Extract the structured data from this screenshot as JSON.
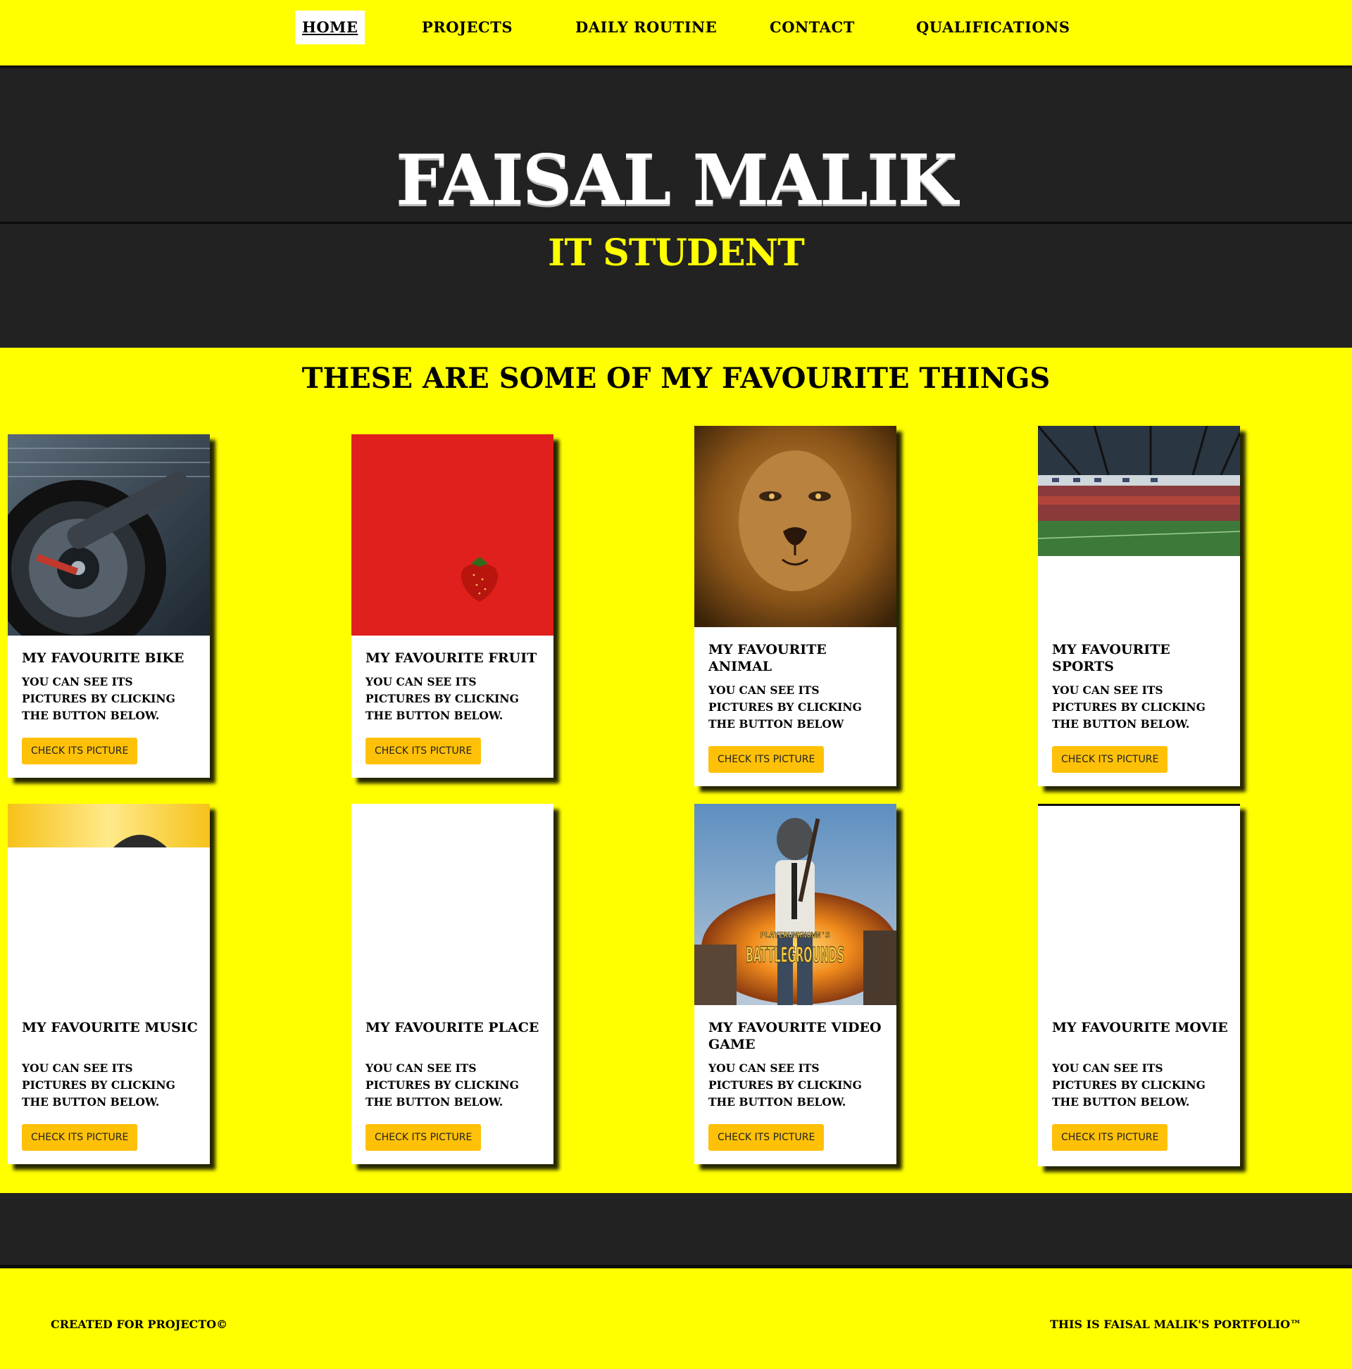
{
  "nav": {
    "items": [
      {
        "label": "HOME",
        "active": true
      },
      {
        "label": "PROJECTS"
      },
      {
        "label": "DAILY ROUTINE"
      },
      {
        "label": "CONTACT"
      },
      {
        "label": "QUALIFICATIONS"
      }
    ]
  },
  "hero": {
    "title": "FAISAL MALIK",
    "subtitle": "IT STUDENT"
  },
  "section": {
    "title": "THESE ARE SOME OF MY FAVOURITE THINGS"
  },
  "cards": [
    {
      "title": "MY FAVOURITE BIKE",
      "text": "YOU CAN SEE ITS PICTURES BY CLICKING THE BUTTON BELOW.",
      "button": "CHECK ITS PICTURE",
      "image": "motorcycle-wheel"
    },
    {
      "title": "MY FAVOURITE FRUIT",
      "text": "YOU CAN SEE ITS PICTURES BY CLICKING THE BUTTON BELOW.",
      "button": "CHECK ITS PICTURE",
      "image": "strawberry-on-red"
    },
    {
      "title": "MY FAVOURITE ANIMAL",
      "text": "YOU CAN SEE ITS PICTURES BY CLICKING THE BUTTON BELOW",
      "button": "CHECK ITS PICTURE",
      "image": "lion-face"
    },
    {
      "title": "MY FAVOURITE SPORTS",
      "text": "YOU CAN SEE ITS PICTURES BY CLICKING THE BUTTON BELOW.",
      "button": "CHECK ITS PICTURE",
      "image": "football-stadium"
    },
    {
      "title": "MY FAVOURITE MUSIC",
      "text": "YOU CAN SEE ITS PICTURES BY CLICKING THE BUTTON BELOW.",
      "button": "CHECK ITS PICTURE",
      "image": "headphones-partial"
    },
    {
      "title": "MY FAVOURITE PLACE",
      "text": "YOU CAN SEE ITS PICTURES BY CLICKING THE BUTTON BELOW.",
      "button": "CHECK ITS PICTURE",
      "image": "blank"
    },
    {
      "title": "MY FAVOURITE VIDEO GAME",
      "text": "YOU CAN SEE ITS PICTURES BY CLICKING THE BUTTON BELOW.",
      "button": "CHECK ITS PICTURE",
      "image": "pubg-battlegrounds",
      "image_label_top": "PLAYERUNKNOWN'S",
      "image_label_bottom": "BATTLEGROUNDS"
    },
    {
      "title": "MY FAVOURITE MOVIE",
      "text": "YOU CAN SEE ITS PICTURES BY CLICKING THE BUTTON BELOW.",
      "button": "CHECK ITS PICTURE",
      "image": "blank"
    }
  ],
  "footer": {
    "left": "CREATED FOR PROJECTO©",
    "right": "THIS IS FAISAL MALIK'S PORTFOLIO™"
  },
  "colors": {
    "background": "#ffff00",
    "dark": "#222222",
    "button": "#ffc107",
    "card": "#ffffff"
  }
}
